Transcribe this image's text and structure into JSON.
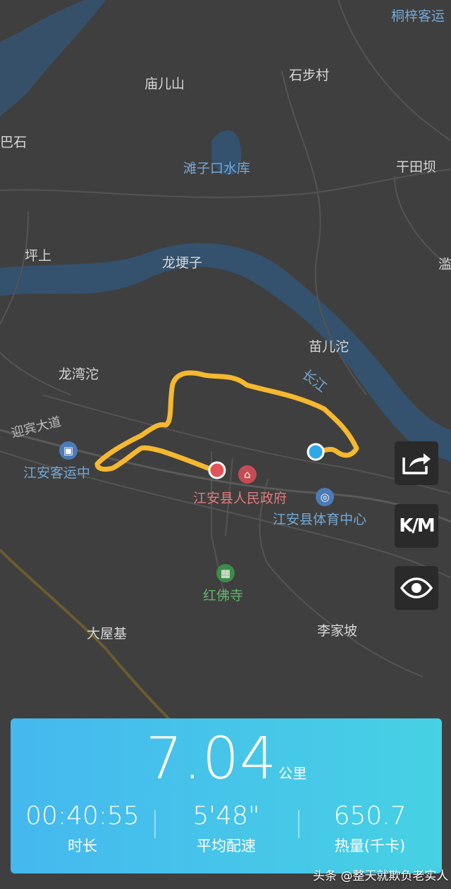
{
  "map": {
    "labels": {
      "tongzi": "桐梓客运",
      "miaoershan": "庙儿山",
      "shibucun": "石步村",
      "bashi": "巴石",
      "tanzikou": "滩子口水库",
      "gantianba": "干田坝",
      "pingshang": "坪上",
      "longgengzi": "龙埂子",
      "rightedge": "滥",
      "miaoertuo": "苗儿沱",
      "changjiang": "长江",
      "longwantuo": "龙湾沱",
      "yingbin": "迎宾大道",
      "jiangan_bus": "江安客运中",
      "jiangan_gov": "江安县人民政府",
      "jiangan_sports": "江安县体育中心",
      "hongfosi": "红佛寺",
      "dawuji": "大屋基",
      "lijiapo": "李家坡"
    },
    "poi_icons": {
      "bus": "bus-icon",
      "gov": "government-icon",
      "sports": "sports-center-icon",
      "temple": "temple-icon"
    },
    "route_color": "#f5b82e",
    "start_color": "#2fa8e8",
    "end_color": "#e2545a"
  },
  "controls": {
    "share": "share-icon",
    "unit_toggle": "K/M",
    "visibility": "eye-icon"
  },
  "summary": {
    "distance": "7.04",
    "distance_unit": "公里",
    "duration_value": "00:40:55",
    "duration_label": "时长",
    "pace_value": "5'48\"",
    "pace_label": "平均配速",
    "calories_value": "650.7",
    "calories_label": "热量(千卡)"
  },
  "watermark": "头条 @整天就欺负老实人"
}
